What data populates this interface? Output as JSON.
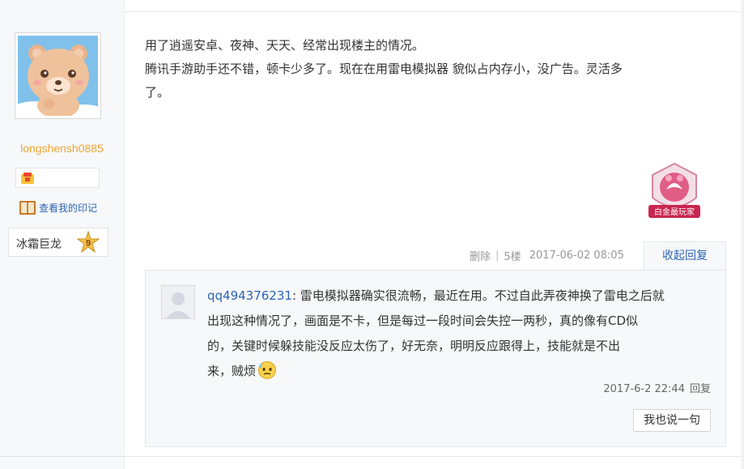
{
  "author": {
    "username": "longshensh0885",
    "imprint_label": "查看我的印记",
    "level_name": "冰霜巨龙",
    "level_number": "9"
  },
  "post": {
    "lines": [
      "用了逍遥安卓、夜神、天天、经常出现楼主的情况。",
      "腾讯手游助手还不错，顿卡少多了。现在在用雷电模拟器 貌似占内存小，没广告。灵活多",
      "了。"
    ],
    "medal_label": "白金最玩家",
    "delete_label": "删除",
    "floor": "5楼",
    "datetime": "2017-06-02 08:05",
    "fold_label": "收起回复"
  },
  "reply": {
    "user": "qq494376231",
    "lines": [
      "雷电模拟器确实很流畅，最近在用。不过自此弄夜神换了雷电之后就",
      "出现这种情况了，画面是不卡，但是每过一段时间会失控一两秒，真的像有CD似",
      "的，关键时候躲技能没反应太伤了，好无奈，明明反应跟得上，技能就是不出",
      "来，贼烦"
    ],
    "datetime": "2017-6-2 22:44",
    "reply_label": "回复",
    "say_button": "我也说一句"
  },
  "colors": {
    "username": "#f0a534",
    "link": "#2d64b3",
    "sidebar_bg": "#f7f8fa"
  },
  "icons": [
    "bear-avatar",
    "badge-icon",
    "book-icon",
    "level-star-icon",
    "medal-icon",
    "default-avatar",
    "sweat-emoji"
  ]
}
